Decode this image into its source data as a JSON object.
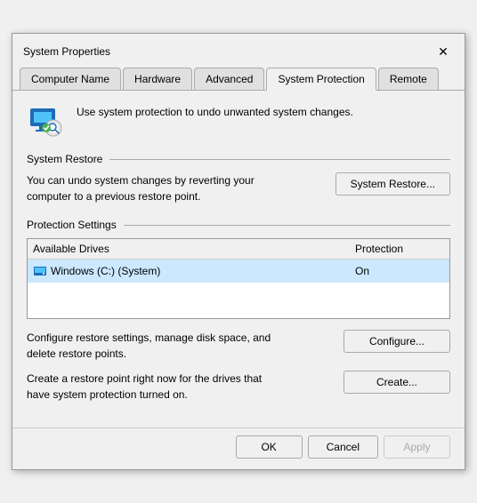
{
  "dialog": {
    "title": "System Properties",
    "close_label": "✕"
  },
  "tabs": [
    {
      "id": "computer-name",
      "label": "Computer Name",
      "active": false
    },
    {
      "id": "hardware",
      "label": "Hardware",
      "active": false
    },
    {
      "id": "advanced",
      "label": "Advanced",
      "active": false
    },
    {
      "id": "system-protection",
      "label": "System Protection",
      "active": true
    },
    {
      "id": "remote",
      "label": "Remote",
      "active": false
    }
  ],
  "header": {
    "text": "Use system protection to undo unwanted system changes."
  },
  "system_restore_section": {
    "label": "System Restore",
    "description": "You can undo system changes by reverting\nyour computer to a previous restore point.",
    "button_label": "System Restore..."
  },
  "protection_settings_section": {
    "label": "Protection Settings",
    "table": {
      "columns": [
        "Available Drives",
        "Protection"
      ],
      "rows": [
        {
          "drive": "Windows (C:) (System)",
          "protection": "On"
        }
      ]
    },
    "configure_text": "Configure restore settings, manage disk space, and\ndelete restore points.",
    "configure_button": "Configure...",
    "create_text": "Create a restore point right now for the drives that\nhave system protection turned on.",
    "create_button": "Create..."
  },
  "footer": {
    "ok_label": "OK",
    "cancel_label": "Cancel",
    "apply_label": "Apply"
  }
}
